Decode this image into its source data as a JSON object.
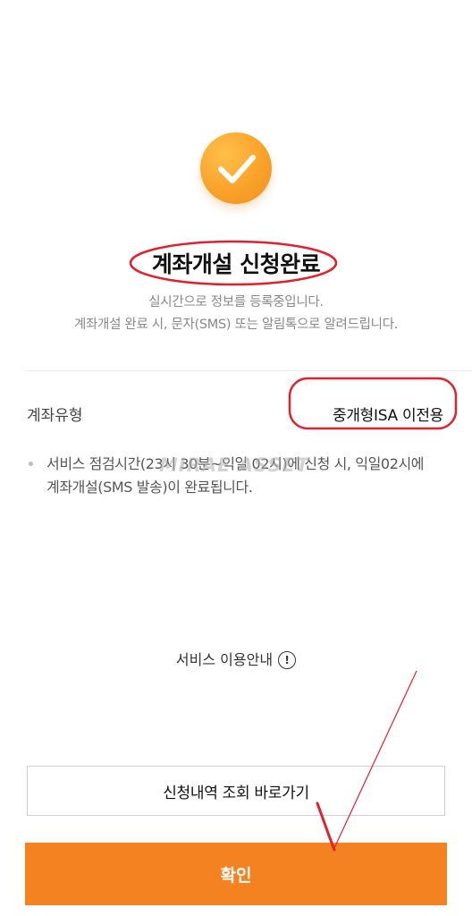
{
  "success": {
    "icon": "check-circle-icon",
    "title": "계좌개설 신청완료",
    "line1": "실시간으로 정보를 등록중입니다.",
    "line2": "계좌개설 완료 시, 문자(SMS) 또는 알림톡으로 알려드립니다."
  },
  "account": {
    "label": "계좌유형",
    "value": "중개형ISA 이전용"
  },
  "notice": {
    "text": "서비스 점검시간(23시 30분~익일 02시)에 신청 시, 익일02시에 계좌개설(SMS 발송)이 완료됩니다."
  },
  "watermark": "MIRAE ASSET",
  "service_guide": {
    "label": "서비스 이용안내",
    "icon": "info-icon",
    "icon_glyph": "!"
  },
  "buttons": {
    "history": "신청내역 조회 바로가기",
    "confirm": "확인"
  },
  "colors": {
    "accent": "#f58220",
    "check_circle": "#f9a22a",
    "annotation": "#e0212e"
  }
}
